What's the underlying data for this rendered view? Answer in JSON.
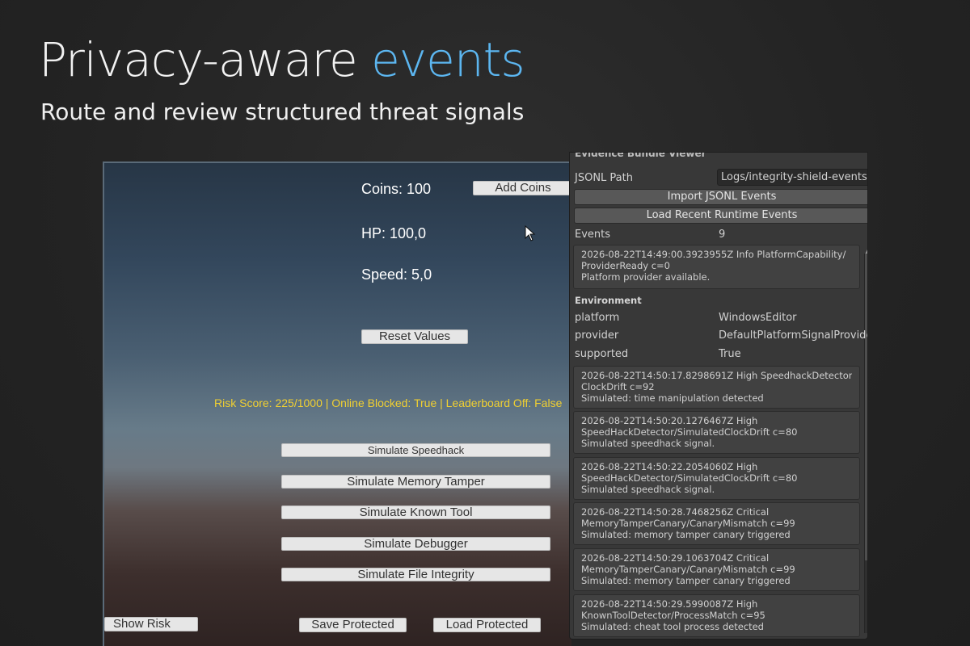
{
  "hero": {
    "title_main": "Privacy-aware ",
    "title_accent": "events",
    "subtitle": "Route and review structured threat signals"
  },
  "colors": {
    "accent": "#5cb6f0",
    "risk_text": "#f1d031",
    "panel_bg": "#383838"
  },
  "game": {
    "coins_label": "Coins: 100",
    "add_coins_button": "Add Coins",
    "hp_label": "HP: 100,0",
    "speed_label": "Speed: 5,0",
    "reset_button": "Reset Values",
    "risk_status": "Risk Score: 225/1000 | Online Blocked: True | Leaderboard Off: False",
    "simulate_buttons": [
      "Simulate Speedhack",
      "Simulate Memory Tamper",
      "Simulate Known Tool",
      "Simulate Debugger",
      "Simulate File Integrity"
    ],
    "show_risk_button": "Show Risk",
    "save_button": "Save Protected",
    "load_button": "Load Protected"
  },
  "inspector": {
    "title": "Evidence Bundle Viewer",
    "jsonl_path_label": "JSONL Path",
    "jsonl_path_value": "Logs/integrity-shield-events",
    "import_button": "Import JSONL Events",
    "load_recent_button": "Load Recent Runtime Events",
    "events_label": "Events",
    "events_count": "9",
    "first_entry": [
      "2026-08-22T14:49:00.3923955Z Info PlatformCapability/",
      "ProviderReady c=0",
      "Platform provider available."
    ],
    "environment_header": "Environment",
    "environment": [
      {
        "key": "platform",
        "value": "WindowsEditor"
      },
      {
        "key": "provider",
        "value": "DefaultPlatformSignalProvider"
      },
      {
        "key": "supported",
        "value": "True"
      }
    ],
    "entries": [
      [
        "2026-08-22T14:50:17.8298691Z High SpeedhackDetector/",
        "ClockDrift c=92",
        "Simulated: time manipulation detected"
      ],
      [
        "2026-08-22T14:50:20.1276467Z High",
        "SpeedHackDetector/SimulatedClockDrift c=80",
        "Simulated speedhack signal."
      ],
      [
        "2026-08-22T14:50:22.2054060Z High",
        "SpeedHackDetector/SimulatedClockDrift c=80",
        "Simulated speedhack signal."
      ],
      [
        "2026-08-22T14:50:28.7468256Z Critical",
        "MemoryTamperCanary/CanaryMismatch c=99",
        "Simulated: memory tamper canary triggered"
      ],
      [
        "2026-08-22T14:50:29.1063704Z Critical",
        "MemoryTamperCanary/CanaryMismatch c=99",
        "Simulated: memory tamper canary triggered"
      ],
      [
        "2026-08-22T14:50:29.5990087Z High",
        "KnownToolDetector/ProcessMatch c=95",
        "Simulated: cheat tool process detected"
      ]
    ]
  }
}
